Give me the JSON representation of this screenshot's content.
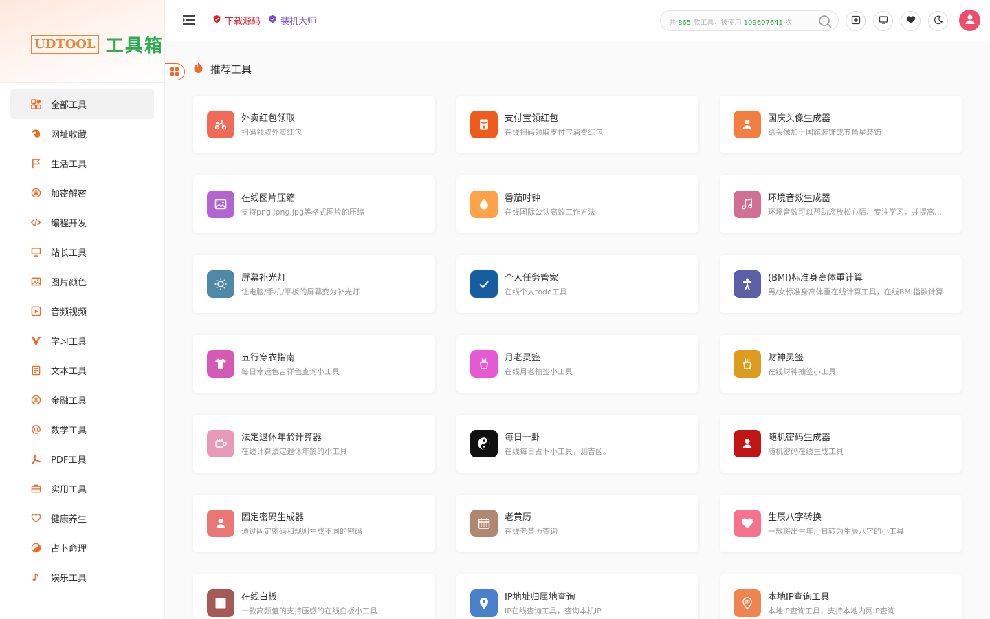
{
  "logo": {
    "box_text": "UDTOOL",
    "cn_text": "工具箱"
  },
  "sidebar": {
    "items": [
      {
        "label": "全部工具",
        "icon": "apps-icon",
        "active": true
      },
      {
        "label": "网址收藏",
        "icon": "edge-icon"
      },
      {
        "label": "生活工具",
        "icon": "flag-icon"
      },
      {
        "label": "加密解密",
        "icon": "lock-circle-icon"
      },
      {
        "label": "编程开发",
        "icon": "code-icon"
      },
      {
        "label": "站长工具",
        "icon": "monitor-icon"
      },
      {
        "label": "图片颜色",
        "icon": "image-icon"
      },
      {
        "label": "音频视频",
        "icon": "play-icon"
      },
      {
        "label": "学习工具",
        "icon": "v-icon"
      },
      {
        "label": "文本工具",
        "icon": "document-icon"
      },
      {
        "label": "金融工具",
        "icon": "yen-icon"
      },
      {
        "label": "数学工具",
        "icon": "at-icon"
      },
      {
        "label": "PDF工具",
        "icon": "pdf-icon"
      },
      {
        "label": "实用工具",
        "icon": "briefcase-icon"
      },
      {
        "label": "健康养生",
        "icon": "heart-icon"
      },
      {
        "label": "占卜命理",
        "icon": "yinyang-icon"
      },
      {
        "label": "娱乐工具",
        "icon": "music-note-icon"
      }
    ]
  },
  "header": {
    "link_download": "下载源码",
    "link_master": "装机大师",
    "search": {
      "prefix": "共",
      "tool_count": "865",
      "mid": "款工具，被使用",
      "use_count": "109607641",
      "suffix": "次"
    }
  },
  "section": {
    "title": "推荐工具"
  },
  "colors": {
    "accent": "#f06a25",
    "brand_green": "#2dab55"
  },
  "cards": [
    {
      "title": "外卖红包领取",
      "desc": "扫码领取外卖红包",
      "color": "#f26a57",
      "icon": "scooter-icon"
    },
    {
      "title": "支付宝领红包",
      "desc": "在线扫码领取支付宝消费红包",
      "color": "#ef5a1d",
      "icon": "red-envelope-icon"
    },
    {
      "title": "国庆头像生成器",
      "desc": "给头像加上国旗装饰或五角星装饰",
      "color": "#f47e3f",
      "icon": "user-icon"
    },
    {
      "title": "在线图片压缩",
      "desc": "支持png,jpng,jpg等格式图片的压缩",
      "color": "#b464d2",
      "icon": "image-icon"
    },
    {
      "title": "番茄时钟",
      "desc": "在线国际公认高效工作方法",
      "color": "#ffa24a",
      "icon": "tomato-icon"
    },
    {
      "title": "环境音效生成器",
      "desc": "环境音效可以帮助您放松心情、专注学习，并提高工作效率",
      "color": "#d16f94",
      "icon": "music-icon"
    },
    {
      "title": "屏幕补光灯",
      "desc": "让电脑/手机/平板的屏幕变为补光灯",
      "color": "#4f89a8",
      "icon": "sun-icon"
    },
    {
      "title": "个人任务管家",
      "desc": "在线个人todo工具",
      "color": "#155fa0",
      "icon": "check-icon"
    },
    {
      "title": "(BMI)标准身高体重计算",
      "desc": "男/女标准身高体重在线计算工具，在线BMI指数计算",
      "color": "#5b5fa6",
      "icon": "person-icon"
    },
    {
      "title": "五行穿衣指南",
      "desc": "每日幸运色吉祥色查询小工具",
      "color": "#d65ab5",
      "icon": "shirt-icon"
    },
    {
      "title": "月老灵签",
      "desc": "在线月老抽签小工具",
      "color": "#e35ad2",
      "icon": "lot-icon"
    },
    {
      "title": "财神灵签",
      "desc": "在线财神抽签小工具",
      "color": "#dd9c20",
      "icon": "lot-icon"
    },
    {
      "title": "法定退休年龄计算器",
      "desc": "在线计算法定退休年龄的小工具",
      "color": "#e69ab7",
      "icon": "cup-icon"
    },
    {
      "title": "每日一卦",
      "desc": "在线每日占卜小工具，测吉凶。",
      "color": "#111111",
      "icon": "yinyang-icon"
    },
    {
      "title": "随机密码生成器",
      "desc": "随机密码在线生成工具",
      "color": "#c11515",
      "icon": "user-icon"
    },
    {
      "title": "固定密码生成器",
      "desc": "通过固定密码和规则生成不同的密码",
      "color": "#eb7774",
      "icon": "user-icon"
    },
    {
      "title": "老黄历",
      "desc": "在线老黄历查询",
      "color": "#b08872",
      "icon": "calendar-icon"
    },
    {
      "title": "生辰八字转换",
      "desc": "一款将出生年月日转为生辰八字的小工具",
      "color": "#f5738f",
      "icon": "heart-icon"
    },
    {
      "title": "在线白板",
      "desc": "一款高颜值的支持压感的在线白板小工具",
      "color": "#a55a57",
      "icon": "square-icon"
    },
    {
      "title": "IP地址归属地查询",
      "desc": "IP在线查询工具，查询本机IP",
      "color": "#4a7fcb",
      "icon": "location-icon"
    },
    {
      "title": "本地IP查询工具",
      "desc": "本地IP查询工具，支持本地内网IP查询",
      "color": "#ef8450",
      "icon": "ip-icon"
    }
  ]
}
